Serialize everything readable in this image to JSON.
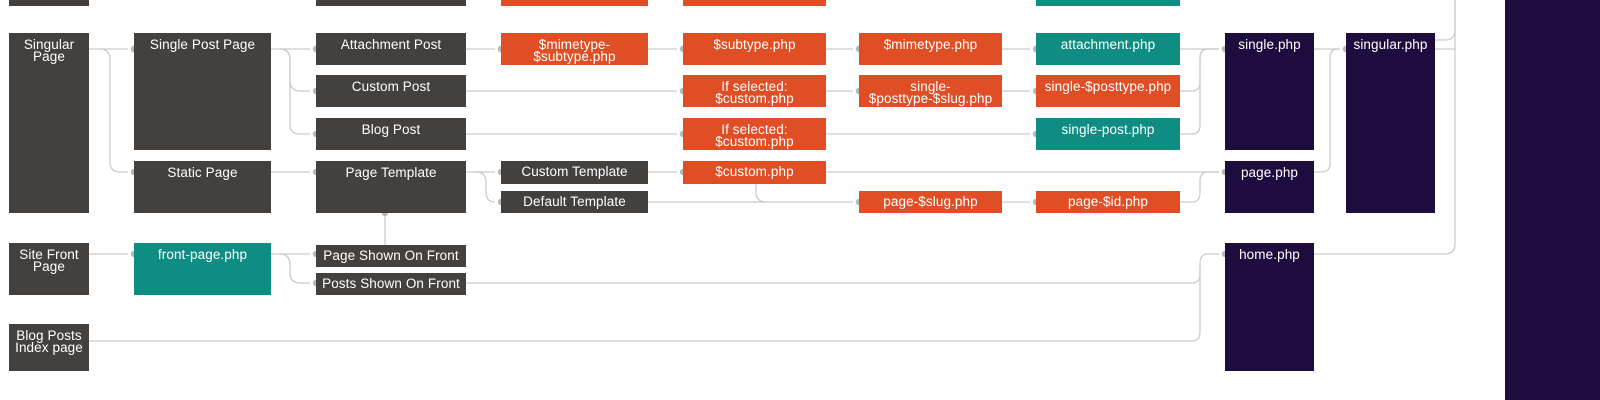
{
  "colors": {
    "dark": "#43403e",
    "orange": "#e04e25",
    "teal": "#0f8d83",
    "purple": "#1f0c3e",
    "line": "#c9c9c9"
  },
  "nodes": {
    "singular_page": "Singular\nPage",
    "site_front_page": "Site Front\nPage",
    "blog_posts_index_page": "Blog Posts\nIndex page",
    "single_post_page": "Single Post Page",
    "static_page": "Static Page",
    "front_page_php": "front-page.php",
    "attachment_post": "Attachment Post",
    "custom_post": "Custom Post",
    "blog_post": "Blog Post",
    "page_template": "Page Template",
    "page_shown_on_front": "Page Shown On Front",
    "posts_shown_on_front": "Posts Shown On Front",
    "mimetype_subtype_php": "$mimetype-\n$subtype.php",
    "custom_template": "Custom Template",
    "default_template": "Default Template",
    "subtype_php": "$subtype.php",
    "if_selected_custom_1": "If selected:\n$custom.php",
    "if_selected_custom_2": "If selected:\n$custom.php",
    "custom_php": "$custom.php",
    "mimetype_php": "$mimetype.php",
    "single_posttype_slug_php": "single-\n$posttype-$slug.php",
    "page_slug_php": "page-$slug.php",
    "attachment_php": "attachment.php",
    "single_posttype_php": "single-$posttype.php",
    "single_post_php": "single-post.php",
    "page_id_php": "page-$id.php",
    "single_php": "single.php",
    "page_php": "page.php",
    "home_php": "home.php",
    "singular_php": "singular.php"
  }
}
